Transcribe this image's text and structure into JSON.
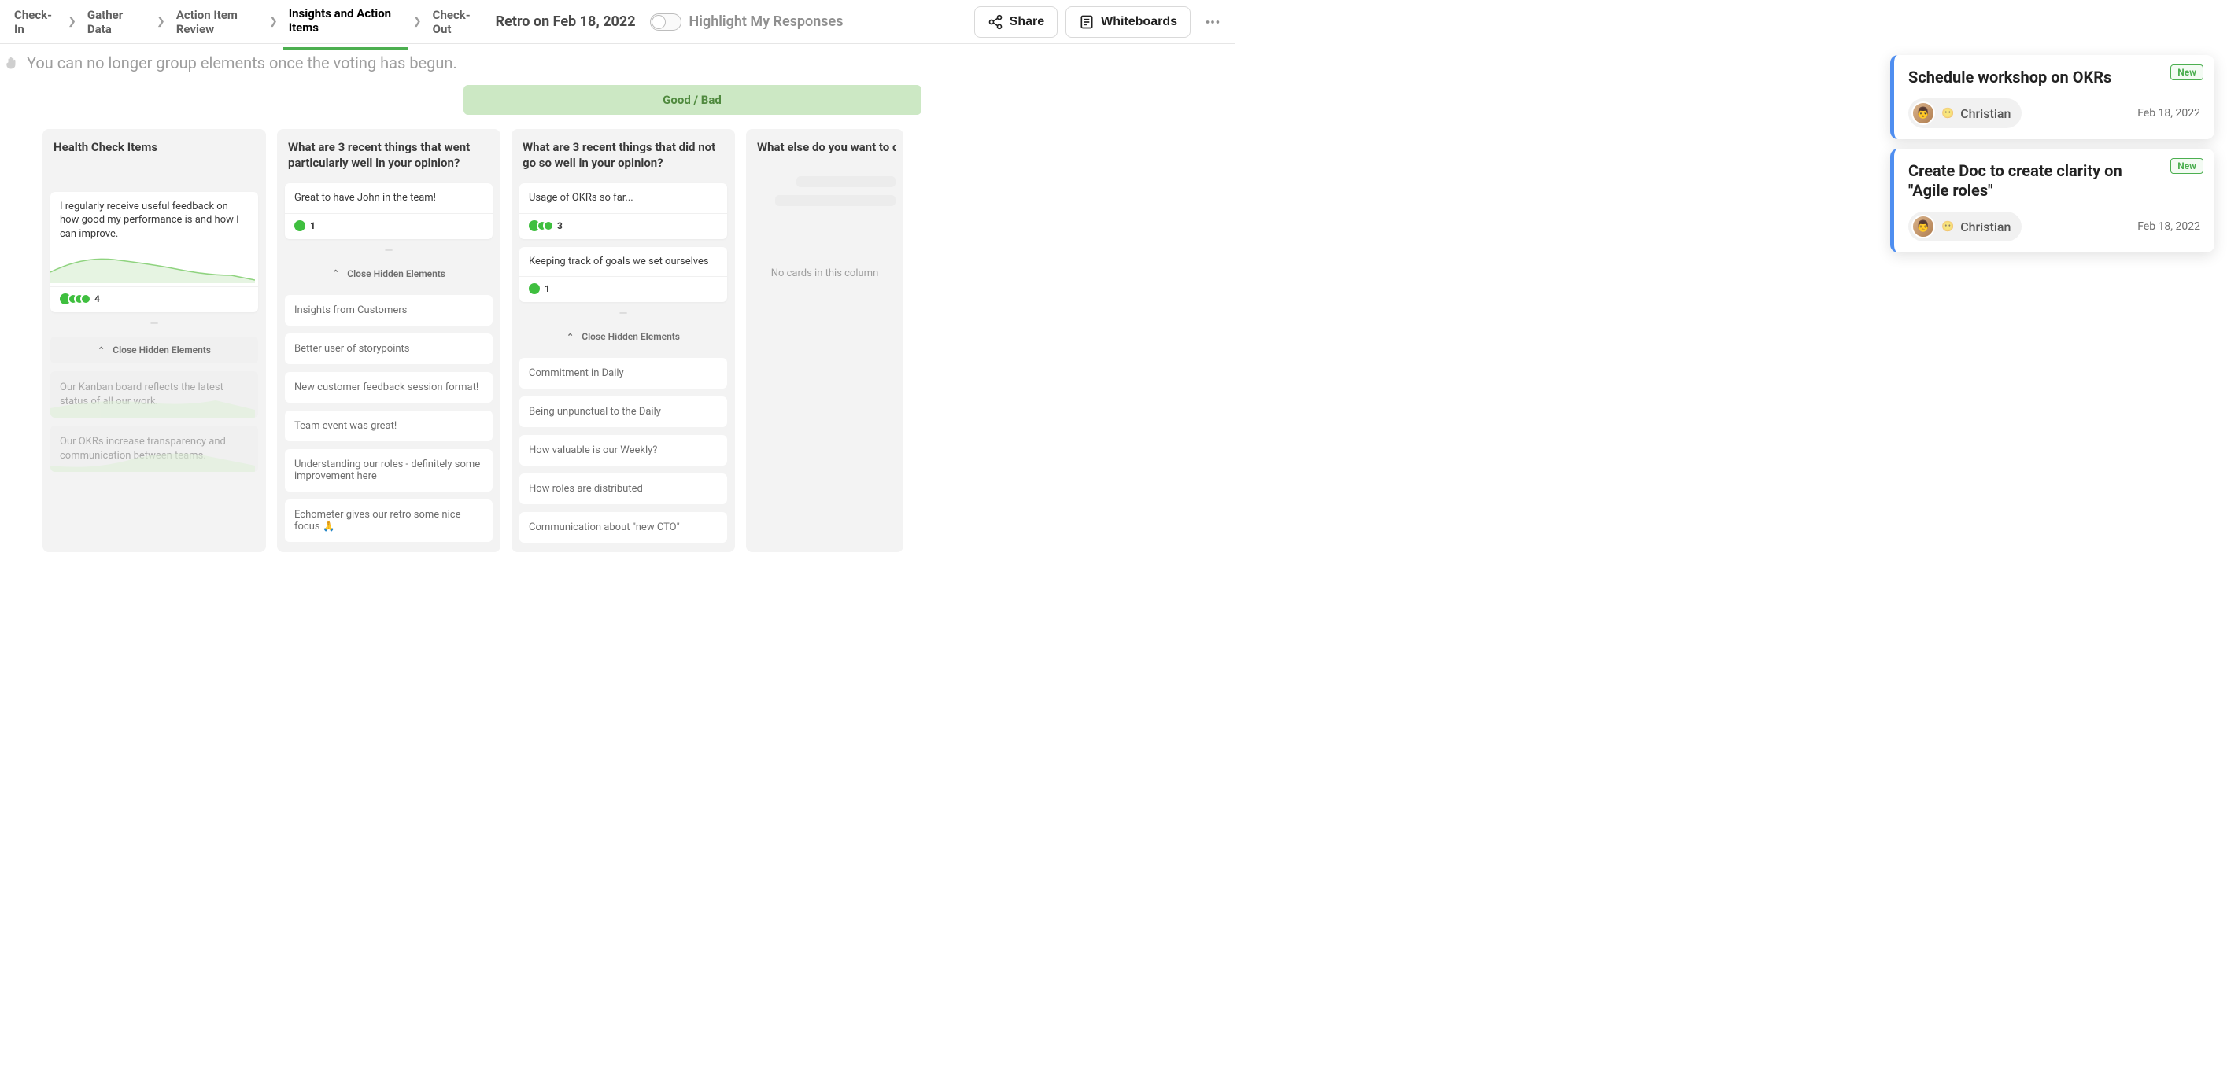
{
  "header": {
    "steps": [
      {
        "label": "Check-In",
        "active": false
      },
      {
        "label": "Gather Data",
        "active": false
      },
      {
        "label": "Action Item Review",
        "active": false
      },
      {
        "label": "Insights and Action Items",
        "active": true
      },
      {
        "label": "Check-Out",
        "active": false
      }
    ],
    "retro_title": "Retro on Feb 18, 2022",
    "highlight_label": "Highlight My Responses",
    "share_label": "Share",
    "whiteboards_label": "Whiteboards"
  },
  "notice": "You can no longer group elements once the voting has begun.",
  "board": {
    "pill": "Good / Bad",
    "columns": [
      {
        "id": "health",
        "title": "Health Check Items",
        "cards": [
          {
            "text": "I regularly receive useful feedback on how good my performance is and how I can improve.",
            "votes": 4,
            "spark": true
          }
        ],
        "close_label": "Close Hidden Elements",
        "ghost": [
          "Our Kanban board reflects the latest status of all our work.",
          "Our OKRs increase transparency and communication between teams."
        ]
      },
      {
        "id": "well",
        "title": "What are 3 recent things that went particularly well in your opinion?",
        "cards": [
          {
            "text": "Great to have John in the team!",
            "votes": 1
          }
        ],
        "close_label": "Close Hidden Elements",
        "simple": [
          "Insights from Customers",
          "Better user of storypoints",
          "New customer feedback session format!",
          "Team event was great!",
          "Understanding our roles - definitely some improvement here",
          "Echometer gives our retro some nice focus 🙏"
        ]
      },
      {
        "id": "notwell",
        "title": "What are 3 recent things that did not go so well in your opinion?",
        "cards": [
          {
            "text": "Usage of OKRs so far...",
            "votes": 3
          },
          {
            "text": "Keeping track of goals we set ourselves",
            "votes": 1
          }
        ],
        "close_label": "Close Hidden Elements",
        "simple": [
          "Commitment in Daily",
          "Being unpunctual to the Daily",
          "How valuable is our Weekly?",
          "How roles are distributed",
          "Communication about \"new CTO\""
        ]
      },
      {
        "id": "else",
        "title": "What else do you want to discuss in our retro?",
        "empty_text": "No cards in this column"
      }
    ]
  },
  "actions_panel": [
    {
      "title": "Schedule workshop on OKRs",
      "badge": "New",
      "assignee": "Christian",
      "date": "Feb 18, 2022"
    },
    {
      "title": "Create Doc to create clarity on \"Agile roles\"",
      "badge": "New",
      "assignee": "Christian",
      "date": "Feb 18, 2022"
    }
  ]
}
